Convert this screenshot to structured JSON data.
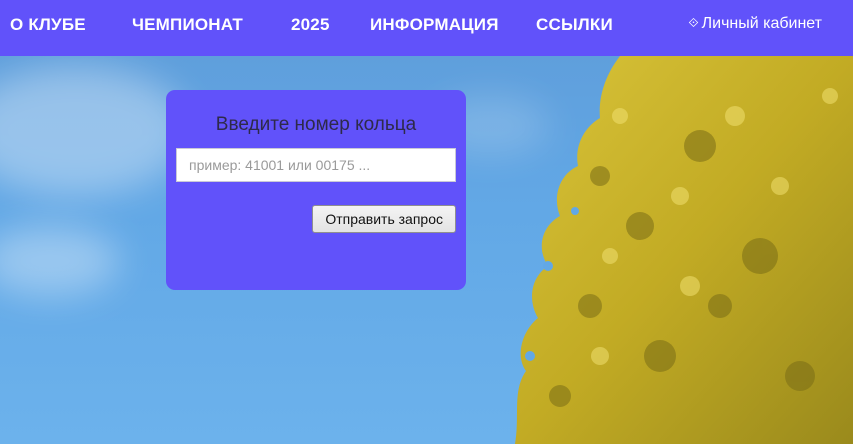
{
  "nav": {
    "items": [
      {
        "label": "О КЛУБЕ"
      },
      {
        "label": "ЧЕМПИОНАТ"
      },
      {
        "label": "2025"
      },
      {
        "label": "ИНФОРМАЦИЯ"
      },
      {
        "label": "ССЫЛКИ"
      }
    ],
    "cabinet": {
      "icon": "diamond-key-icon",
      "glyph": "⟐",
      "label": "Личный кабинет"
    }
  },
  "ring_search": {
    "title": "Введите номер кольца",
    "input_value": "",
    "input_placeholder": "пример: 41001 или 00175 ...",
    "submit_label": "Отправить запрос"
  },
  "colors": {
    "nav_background": "#6152fa",
    "card_background": "#6152fa",
    "sky": "#62a8e6",
    "foliage": "#c9b52a"
  }
}
